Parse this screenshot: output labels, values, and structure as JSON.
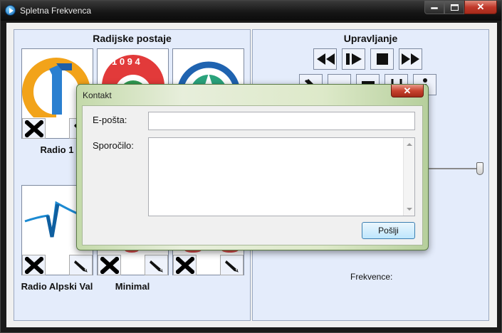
{
  "window": {
    "title": "Spletna Frekvenca",
    "close_glyph": "✕",
    "icons": {
      "app": "play-app-icon",
      "minimize": "minimize-icon",
      "maximize": "maximize-icon",
      "close": "close-icon"
    }
  },
  "stations_panel": {
    "title": "Radijske postaje",
    "stations": [
      {
        "name": "Radio 1",
        "logo": "radio1-logo"
      },
      {
        "name": "",
        "logo": "1094-logo"
      },
      {
        "name": "",
        "logo": "a-logo"
      },
      {
        "name": "Radio Alpski Val",
        "logo": "alpski-val-logo"
      },
      {
        "name": "Minimal",
        "logo": ""
      },
      {
        "name": "",
        "logo": ""
      }
    ],
    "delete_icon": "delete-x-icon",
    "edit_icon": "pencil-icon"
  },
  "controls_panel": {
    "title": "Upravljanje",
    "buttons": [
      "rewind-icon",
      "play-pause-icon",
      "stop-icon",
      "fast-forward-icon",
      "settings-icon",
      "minus-icon",
      "menu-icon",
      "bracket-icon",
      "info-icon"
    ],
    "frequencies_label": "Frekvence:"
  },
  "dialog": {
    "title": "Kontakt",
    "close_glyph": "✕",
    "email_label": "E-pošta:",
    "email_value": "",
    "message_label": "Sporočilo:",
    "message_value": "",
    "send_label": "Pošlji",
    "colors": {
      "frame": "#c3d9a9",
      "close": "#c8432f"
    }
  }
}
